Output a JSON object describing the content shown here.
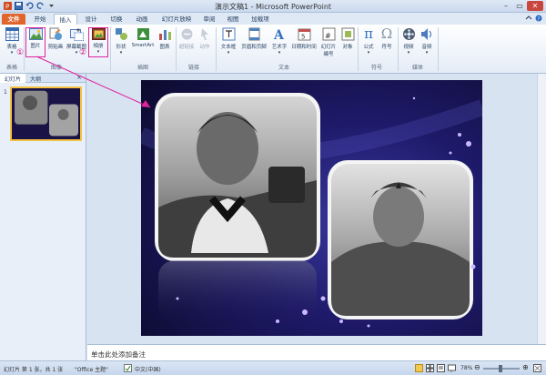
{
  "window": {
    "title": "演示文稿1 - Microsoft PowerPoint"
  },
  "tabs": [
    "文件",
    "开始",
    "插入",
    "设计",
    "切换",
    "动画",
    "幻灯片放映",
    "审阅",
    "视图",
    "加载项"
  ],
  "ribbon": {
    "groups": {
      "tables": "表格",
      "images": "图像",
      "illustrations": "插图",
      "links": "链接",
      "text": "文本",
      "symbols": "符号",
      "media": "媒体"
    },
    "buttons": {
      "table": "表格",
      "picture": "图片",
      "clipart": "剪贴画",
      "screenshot": "屏幕截图",
      "album": "相册",
      "shapes": "形状",
      "smartart": "SmartArt",
      "chart": "图表",
      "hyperlink": "超链接",
      "action": "动作",
      "textbox": "文本框",
      "header_footer": "页眉和页脚",
      "wordart": "艺术字",
      "datetime": "日期和时间",
      "slide_number_1": "幻灯片",
      "slide_number_2": "编号",
      "object": "对象",
      "equation": "公式",
      "symbol": "符号",
      "video": "视频",
      "audio": "音频"
    },
    "markers": {
      "one": "①",
      "two": "②"
    }
  },
  "panel": {
    "tab_slides": "幻灯片",
    "tab_outline": "大纲",
    "close": "×",
    "slide_number": "1"
  },
  "notes": {
    "placeholder": "单击此处添加备注"
  },
  "status": {
    "slide_info": "幻灯片 第 1 张，共 1 张",
    "theme": "\"Office 主题\"",
    "language": "中文(中国)",
    "zoom": "78%"
  },
  "colors": {
    "file_tab": "#e1642c",
    "highlight": "#e0249e",
    "slide_bg": "#1a1446"
  }
}
